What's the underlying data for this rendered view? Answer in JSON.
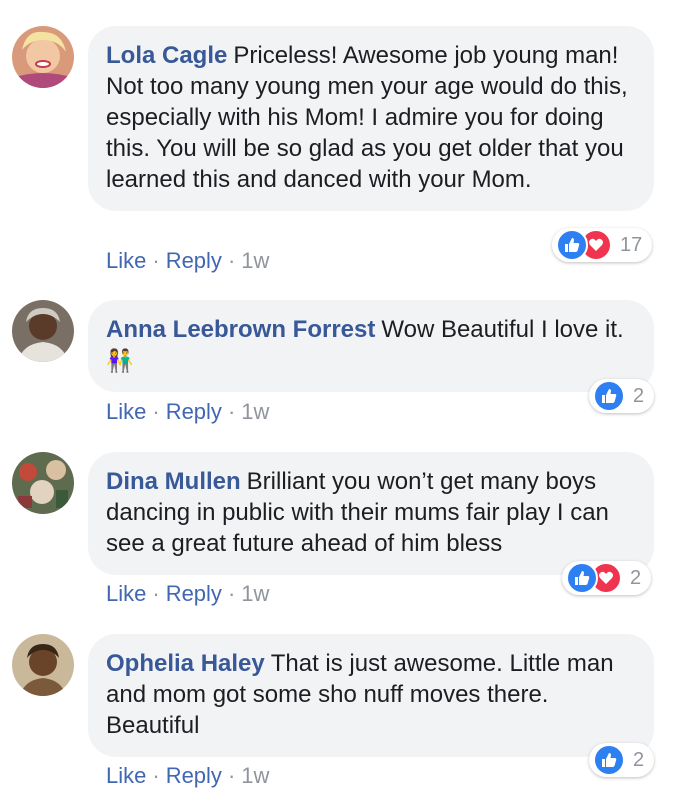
{
  "comments": [
    {
      "author": "Lola Cagle",
      "text": "Priceless! Awesome job young man! Not too many young men your age would do this, especially with his Mom! I admire you for doing this. You will be so glad as you get older that you learned this and danced with your Mom.",
      "emoji": "",
      "like_label": "Like",
      "reply_label": "Reply",
      "time": "1w",
      "reaction_count": "17",
      "reactions": [
        "like",
        "love"
      ],
      "avatar_color": "#e8c9a8"
    },
    {
      "author": "Anna Leebrown Forrest",
      "text": "Wow Beautiful I love it.",
      "emoji": "👫",
      "like_label": "Like",
      "reply_label": "Reply",
      "time": "1w",
      "reaction_count": "2",
      "reactions": [
        "like"
      ],
      "avatar_color": "#5a4e46"
    },
    {
      "author": "Dina Mullen",
      "text": "Brilliant you won’t get many boys dancing in public with their mums fair play I can see a great future ahead of him bless",
      "emoji": "",
      "like_label": "Like",
      "reply_label": "Reply",
      "time": "1w",
      "reaction_count": "2",
      "reactions": [
        "like",
        "love"
      ],
      "avatar_color": "#6b7a5a"
    },
    {
      "author": "Ophelia Haley",
      "text": "That is just awesome. Little man and mom got some sho nuff moves there. Beautiful",
      "emoji": "",
      "like_label": "Like",
      "reply_label": "Reply",
      "time": "1w",
      "reaction_count": "2",
      "reactions": [
        "like"
      ],
      "avatar_color": "#8a6a3a"
    }
  ],
  "colors": {
    "author": "#385898",
    "link": "#4267b2",
    "meta": "#90949c",
    "bubble": "#f2f3f5",
    "like": "#2e7ff1",
    "love": "#f0344f"
  }
}
